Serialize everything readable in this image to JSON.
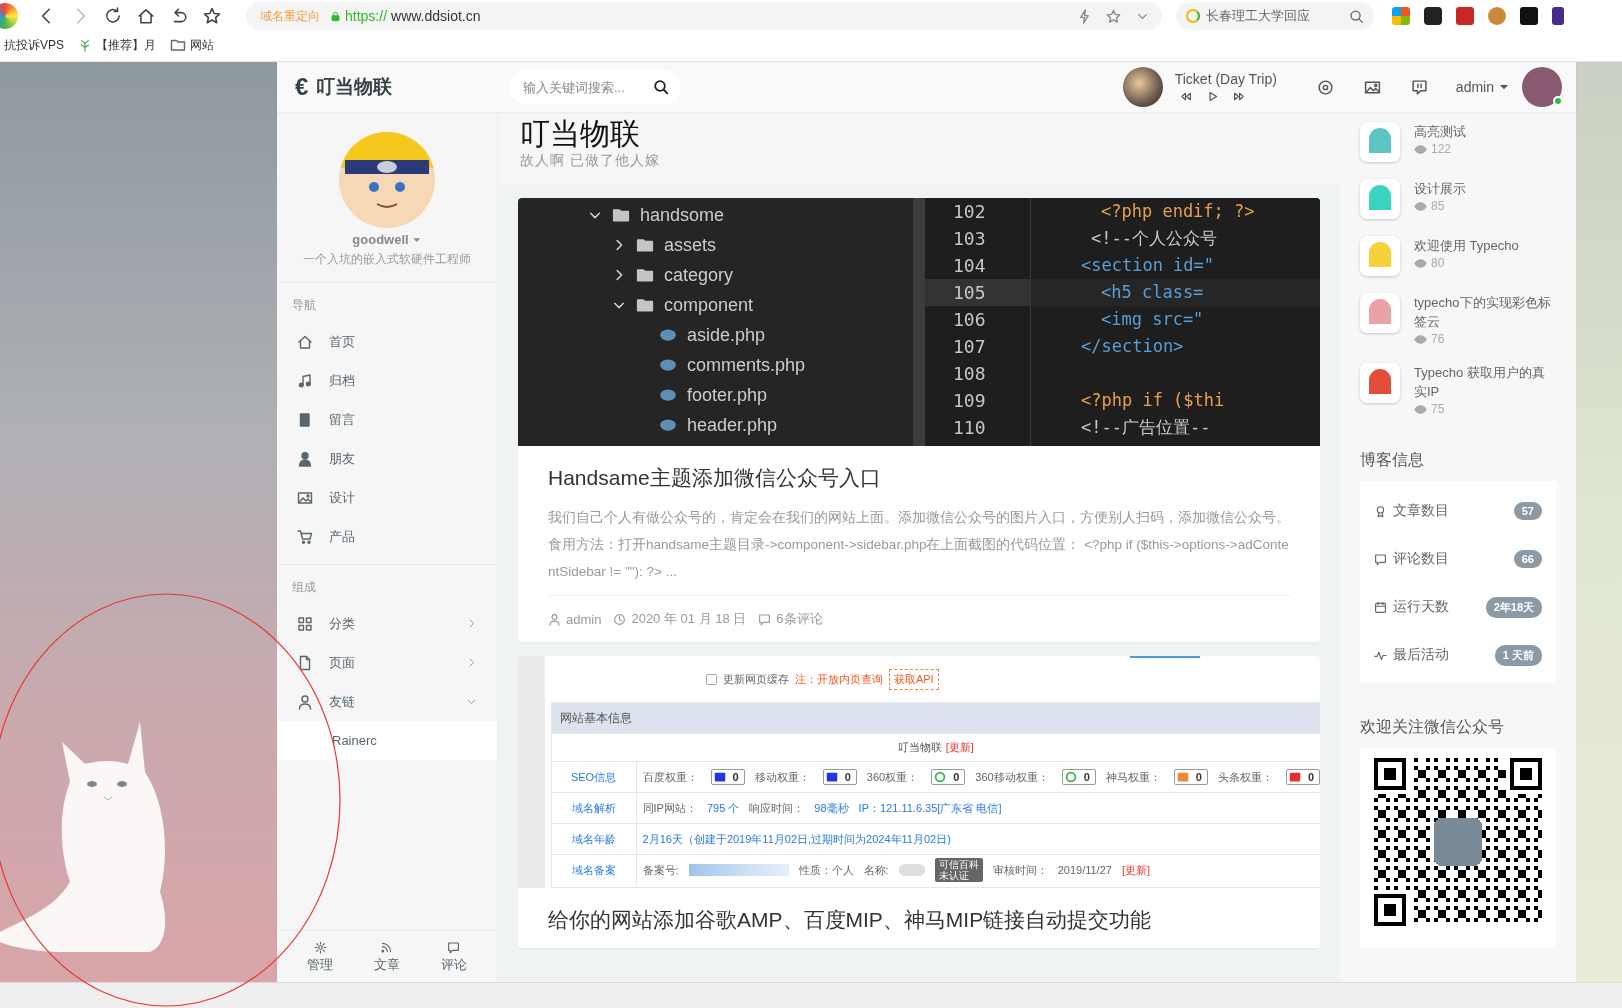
{
  "browser": {
    "redirect_note": "域名重定向",
    "url_scheme": "https://",
    "url_host": "www.ddsiot.cn",
    "search_text": "长春理工大学回应",
    "bookmarks": [
      {
        "label": "抗投诉VPS"
      },
      {
        "label": "【推荐】月"
      },
      {
        "label": "网站"
      }
    ]
  },
  "header": {
    "logo_symbol": "€",
    "logo_text": "叮当物联",
    "search": {
      "placeholder": "输入关键词搜索..."
    },
    "player": {
      "track": "Ticket (Day Trip)"
    },
    "user": {
      "name": "admin",
      "online": true
    }
  },
  "sidebar": {
    "profile": {
      "name": "goodwell",
      "bio": "一个入坑的嵌入式软硬件工程师"
    },
    "sections": [
      {
        "title": "导航",
        "items": [
          {
            "label": "首页"
          },
          {
            "label": "归档"
          },
          {
            "label": "留言"
          },
          {
            "label": "朋友"
          },
          {
            "label": "设计"
          },
          {
            "label": "产品"
          }
        ]
      },
      {
        "title": "组成",
        "items": [
          {
            "label": "分类",
            "expanded": false
          },
          {
            "label": "页面",
            "expanded": false
          },
          {
            "label": "友链",
            "expanded": true,
            "children": [
              {
                "label": "Rainerc"
              }
            ]
          }
        ]
      }
    ],
    "footer_tabs": [
      {
        "label": "管理"
      },
      {
        "label": "文章"
      },
      {
        "label": "评论"
      }
    ]
  },
  "main": {
    "site_title": "叮当物联",
    "tagline": "故人啊 已做了他人嫁",
    "posts": [
      {
        "cover": {
          "kind": "code_editor",
          "tree": [
            {
              "label": "handsome",
              "expanded": true,
              "children": [
                {
                  "label": "assets",
                  "expanded": false
                },
                {
                  "label": "category",
                  "expanded": false
                },
                {
                  "label": "component",
                  "expanded": true,
                  "children": [
                    {
                      "label": "aside.php"
                    },
                    {
                      "label": "comments.php"
                    },
                    {
                      "label": "footer.php"
                    },
                    {
                      "label": "header.php"
                    }
                  ]
                }
              ]
            }
          ],
          "lines": [
            {
              "number": "102",
              "code": "<?php endif; ?>",
              "kind": "php",
              "selected": false
            },
            {
              "number": "103",
              "code": "<!--个人公众号",
              "kind": "comment",
              "selected": false
            },
            {
              "number": "104",
              "code": "<section id=\"",
              "kind": "tag",
              "selected": false
            },
            {
              "number": "105",
              "code": "<h5 class=",
              "kind": "tag",
              "selected": true
            },
            {
              "number": "106",
              "code": "<img src=\"",
              "kind": "tag",
              "selected": false
            },
            {
              "number": "107",
              "code": "</section>",
              "kind": "tag",
              "selected": false
            },
            {
              "number": "108",
              "selected": false
            },
            {
              "number": "109",
              "code": "<?php if ($thi",
              "kind": "php",
              "selected": false
            },
            {
              "number": "110",
              "code": "<!--广告位置--",
              "kind": "comment",
              "selected": false
            }
          ]
        },
        "title": "Handsame主题添加微信公众号入口",
        "excerpt": "我们自己个人有做公众号的，肯定会在我们的网站上面。添加微信公众号的图片入口，方便别人扫码，添加微信公众号。食用方法：打开handsame主题目录->component->sidebar.php在上面截图的代码位置： <?php if ($this->options->adContentSidebar != \"\"): ?> ...",
        "author": "admin",
        "date": "2020 年 01 月 18 日",
        "comments": "6条评论"
      },
      {
        "cover": {
          "kind": "site_info",
          "cache_option": {
            "label": "更新网页缓存",
            "checked": false
          },
          "note": "注：开放内页查询",
          "api_button": "获取API",
          "section_title": "网站基本信息",
          "site_name": "叮当物联",
          "site_update": "[更新]",
          "seo": {
            "label": "SEO信息",
            "weights": [
              {
                "label": "百度权重：",
                "value": "0"
              },
              {
                "label": "移动权重：",
                "value": "0"
              },
              {
                "label": "360权重：",
                "value": "0"
              },
              {
                "label": "360移动权重：",
                "value": "0"
              },
              {
                "label": "神马权重：",
                "value": "0"
              },
              {
                "label": "头条权重：",
                "value": "0"
              }
            ]
          },
          "dns": {
            "label": "域名解析",
            "same_ip_label": "同IP网站：",
            "same_ip_value": "795 个",
            "response_label": "响应时间：",
            "response_value": "98毫秒",
            "ip": "IP：121.11.6.35[广东省 电信]"
          },
          "age": {
            "label": "域名年龄",
            "value": "2月16天（创建于2019年11月02日,过期时间为2024年11月02日)"
          },
          "icp": {
            "label": "域名备案",
            "number_label": "备案号:",
            "nature": "性质：个人",
            "name_label": "名称:",
            "badge_top": "可信百科",
            "badge_bottom": "未认证",
            "review_label": "审核时间：",
            "review_date": "2019/11/27",
            "update": "[更新]"
          }
        },
        "title": "给你的网站添加谷歌AMP、百度MIP、神马MIP链接自动提交功能"
      }
    ]
  },
  "aside": {
    "hot_posts": [
      {
        "title": "高亮测试",
        "views": "122"
      },
      {
        "title": "设计展示",
        "views": "85"
      },
      {
        "title": "欢迎使用 Typecho",
        "views": "80"
      },
      {
        "title": "typecho下的实现彩色标签云",
        "views": "76"
      },
      {
        "title": "Typecho 获取用户的真实IP",
        "views": "75"
      }
    ],
    "blog_info": {
      "title": "博客信息",
      "stats": [
        {
          "label": "文章数目",
          "value": "57"
        },
        {
          "label": "评论数目",
          "value": "66"
        },
        {
          "label": "运行天数",
          "value": "2年18天"
        },
        {
          "label": "最后活动",
          "value": "1 天前"
        }
      ]
    },
    "wechat": {
      "title": "欢迎关注微信公众号"
    }
  }
}
